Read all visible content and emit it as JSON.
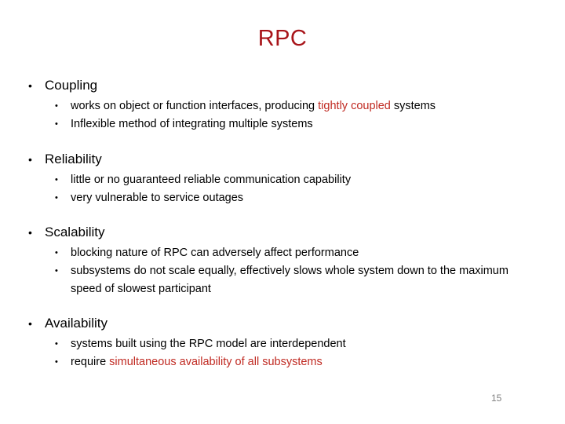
{
  "slide": {
    "title": "RPC",
    "page_number": "15",
    "title_color": "#A81419",
    "accent_red": "#C02A22",
    "background": "#ffffff",
    "bullet_glyph_level1": "•",
    "bullet_glyph_level2": "•"
  },
  "sections": [
    {
      "heading": "Coupling",
      "points": [
        {
          "parts": [
            {
              "text": "works on object or function interfaces, producing ",
              "color": "black"
            },
            {
              "text": "tightly coupled",
              "color": "red"
            },
            {
              "text": " systems",
              "color": "black"
            }
          ]
        },
        {
          "parts": [
            {
              "text": "Inflexible method of integrating multiple systems",
              "color": "black"
            }
          ]
        }
      ]
    },
    {
      "heading": "Reliability",
      "points": [
        {
          "parts": [
            {
              "text": "little or no guaranteed reliable communication capability",
              "color": "black"
            }
          ]
        },
        {
          "parts": [
            {
              "text": "very vulnerable to service outages",
              "color": "black"
            }
          ]
        }
      ]
    },
    {
      "heading": "Scalability",
      "points": [
        {
          "parts": [
            {
              "text": "blocking nature of RPC can adversely affect performance",
              "color": "black"
            }
          ]
        },
        {
          "parts": [
            {
              "text": "subsystems do not scale equally, effectively slows whole system down to the maximum speed of slowest participant",
              "color": "black"
            }
          ]
        }
      ]
    },
    {
      "heading": "Availability",
      "points": [
        {
          "parts": [
            {
              "text": "systems built using the RPC model are interdependent",
              "color": "black"
            }
          ]
        },
        {
          "parts": [
            {
              "text": "require ",
              "color": "black"
            },
            {
              "text": "simultaneous availability of all subsystems",
              "color": "red"
            }
          ]
        }
      ]
    }
  ]
}
